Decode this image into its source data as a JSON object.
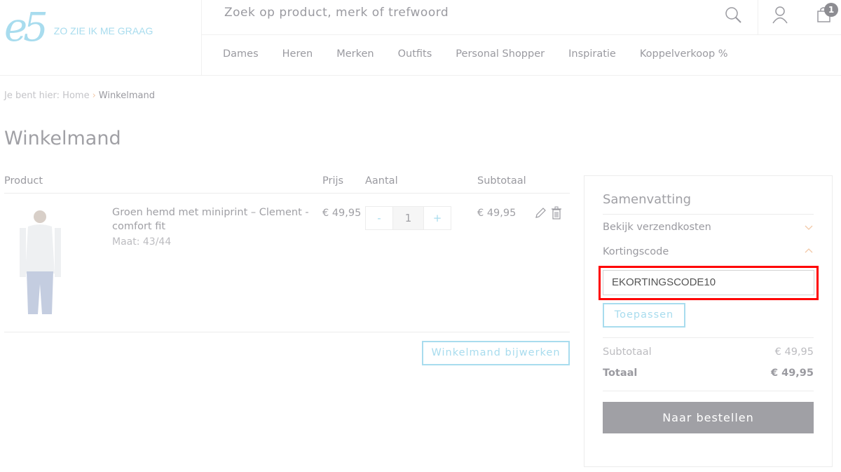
{
  "header": {
    "logo_mark": "e5",
    "slogan": "ZO ZIE IK ME GRAAG",
    "search_placeholder": "Zoek op product, merk of trefwoord",
    "cart_count": "1",
    "nav": [
      "Dames",
      "Heren",
      "Merken",
      "Outfits",
      "Personal Shopper",
      "Inspiratie",
      "Koppelverkoop %"
    ]
  },
  "breadcrumb": {
    "prefix": "Je bent hier:",
    "home": "Home",
    "current": "Winkelmand"
  },
  "page_title": "Winkelmand",
  "cart": {
    "columns": {
      "product": "Product",
      "price": "Prijs",
      "qty": "Aantal",
      "subtotal": "Subtotaal"
    },
    "item": {
      "name": "Groen hemd met miniprint – Clement - comfort fit",
      "size": "Maat: 43/44",
      "price": "€ 49,95",
      "qty": "1",
      "minus": "-",
      "plus": "+",
      "subtotal": "€ 49,95"
    },
    "update_label": "Winkelmand bijwerken"
  },
  "summary": {
    "title": "Samenvatting",
    "shipping_label": "Bekijk verzendkosten",
    "coupon_label": "Kortingscode",
    "coupon_value": "EKORTINGSCODE10",
    "apply_label": "Toepassen",
    "subtotal_label": "Subtotaal",
    "subtotal_value": "€ 49,95",
    "total_label": "Totaal",
    "total_value": "€ 49,95",
    "checkout_label": "Naar bestellen"
  },
  "colors": {
    "accent": "#a8dcee",
    "highlight": "#ff0000",
    "chevron": "#f2c9a8"
  }
}
